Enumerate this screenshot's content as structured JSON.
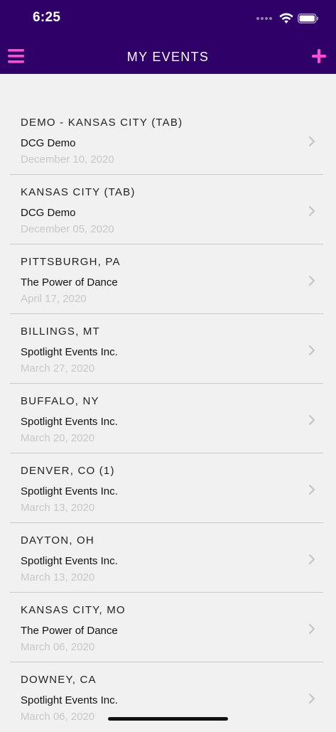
{
  "status_bar": {
    "time": "6:25"
  },
  "header": {
    "title": "MY EVENTS",
    "menu_icon": "hamburger-icon",
    "add_icon": "plus-icon"
  },
  "colors": {
    "header_bg": "#2e0068",
    "accent": "#ff4fd1",
    "list_bg": "#f1f1f1",
    "date_text": "#c7c7c7"
  },
  "events": [
    {
      "title": "DEMO - KANSAS CITY (TAB)",
      "organizer": "DCG Demo",
      "date": "December 10, 2020"
    },
    {
      "title": "KANSAS CITY (TAB)",
      "organizer": "DCG Demo",
      "date": "December 05, 2020"
    },
    {
      "title": "PITTSBURGH, PA",
      "organizer": "The Power of Dance",
      "date": "April 17, 2020"
    },
    {
      "title": "BILLINGS, MT",
      "organizer": "Spotlight Events Inc.",
      "date": "March 27, 2020"
    },
    {
      "title": "BUFFALO, NY",
      "organizer": "Spotlight Events Inc.",
      "date": "March 20, 2020"
    },
    {
      "title": "DENVER, CO (1)",
      "organizer": "Spotlight Events Inc.",
      "date": "March 13, 2020"
    },
    {
      "title": "DAYTON, OH",
      "organizer": "Spotlight Events Inc.",
      "date": "March 13, 2020"
    },
    {
      "title": "KANSAS CITY, MO",
      "organizer": "The Power of Dance",
      "date": "March 06, 2020"
    },
    {
      "title": "DOWNEY, CA",
      "organizer": "Spotlight Events Inc.",
      "date": "March 06, 2020"
    }
  ]
}
